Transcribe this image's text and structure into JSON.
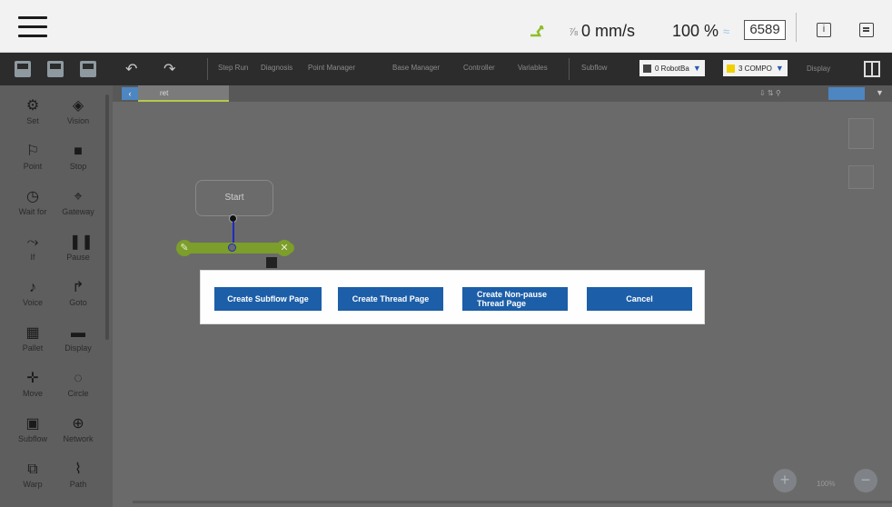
{
  "header": {
    "speed_value": "0 mm/s",
    "speed_prefix_icon": "⅞",
    "percent_value": "100 %",
    "counter_value": "6589",
    "info_icon_glyph": "i"
  },
  "toolbar": {
    "menus": [
      "Step Run",
      "Diagnosis",
      "Point Manager",
      "Base Manager",
      "Controller",
      "Variables"
    ],
    "subflow_label": "Subflow",
    "robot_select": "0 RobotBa",
    "component_select": "3 COMPO",
    "display_label": "Display"
  },
  "sidebar": {
    "items": [
      {
        "label": "Set",
        "glyph": "⚙"
      },
      {
        "label": "Vision",
        "glyph": "◈"
      },
      {
        "label": "Point",
        "glyph": "⚐"
      },
      {
        "label": "Stop",
        "glyph": "■"
      },
      {
        "label": "Wait for",
        "glyph": "◷"
      },
      {
        "label": "Gateway",
        "glyph": "⌖"
      },
      {
        "label": "If",
        "glyph": "⤳"
      },
      {
        "label": "Pause",
        "glyph": "❚❚"
      },
      {
        "label": "Voice",
        "glyph": "♪"
      },
      {
        "label": "Goto",
        "glyph": "↱"
      },
      {
        "label": "Pallet",
        "glyph": "▦"
      },
      {
        "label": "Display",
        "glyph": "▬"
      },
      {
        "label": "Move",
        "glyph": "✛"
      },
      {
        "label": "Circle",
        "glyph": "◌"
      },
      {
        "label": "Subflow",
        "glyph": "▣"
      },
      {
        "label": "Network",
        "glyph": "⊕"
      },
      {
        "label": "Warp",
        "glyph": "⧉"
      },
      {
        "label": "Path",
        "glyph": "⌇"
      }
    ]
  },
  "canvas": {
    "tab_label": "ret",
    "start_node_label": "Start",
    "zoom_label": "100%"
  },
  "dialog": {
    "buttons": [
      "Create Subflow Page",
      "Create Thread Page",
      "Create Non-pause\nThread Page",
      "Cancel"
    ]
  },
  "colors": {
    "accent": "#1c5ea8",
    "connector": "#1b2dbf",
    "node_green": "#7c9e2a"
  }
}
